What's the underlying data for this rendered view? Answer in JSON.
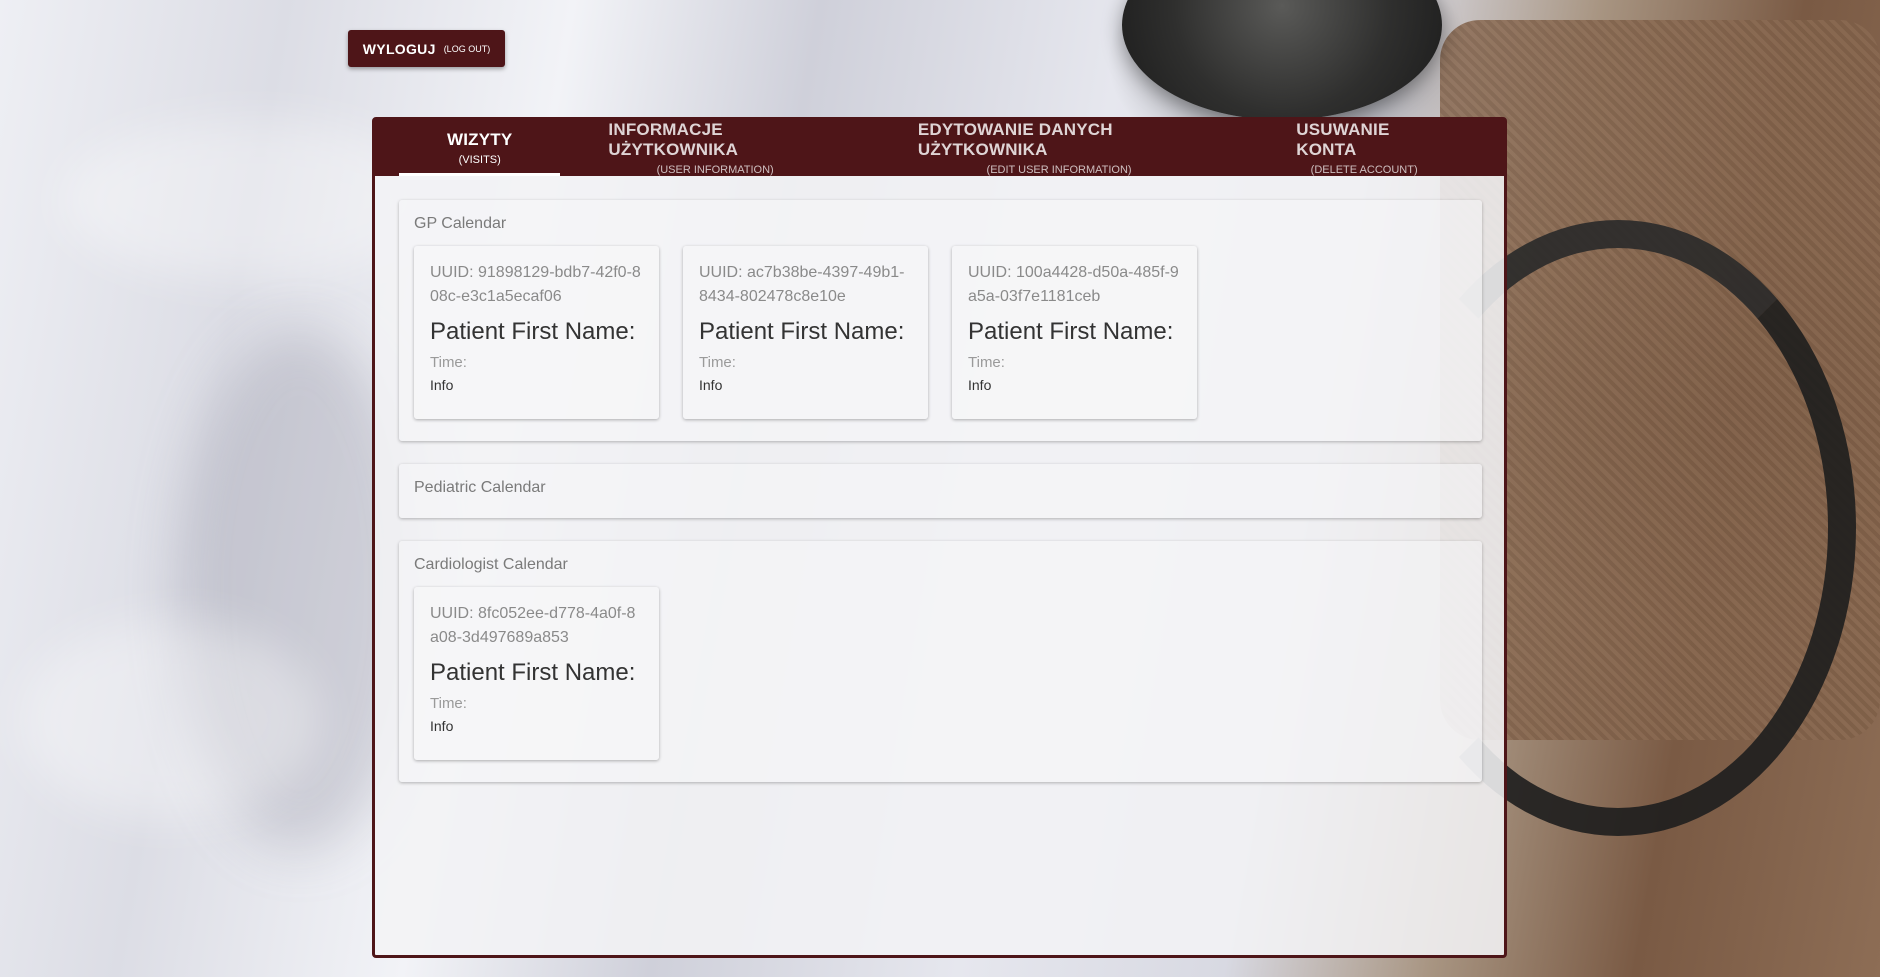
{
  "logout": {
    "label": "WYLOGUJ",
    "sublabel": "(LOG OUT)"
  },
  "tabs": [
    {
      "label": "WIZYTY",
      "sublabel": "(VISITS)",
      "active": true
    },
    {
      "label": "INFORMACJE UŻYTKOWNIKA",
      "sublabel": "(USER INFORMATION)",
      "active": false
    },
    {
      "label": "EDYTOWANIE DANYCH UŻYTKOWNIKA",
      "sublabel": "(EDIT USER INFORMATION)",
      "active": false
    },
    {
      "label": "USUWANIE KONTA",
      "sublabel": "(DELETE ACCOUNT)",
      "active": false
    }
  ],
  "calendars": {
    "gp": {
      "title": "GP Calendar",
      "visits": [
        {
          "uuid": "UUID: 91898129-bdb7-42f0-808c-e3c1a5ecaf06",
          "patient_label": "Patient First Name:",
          "time_label": "Time:",
          "info_label": "Info"
        },
        {
          "uuid": "UUID: ac7b38be-4397-49b1-8434-802478c8e10e",
          "patient_label": "Patient First Name:",
          "time_label": "Time:",
          "info_label": "Info"
        },
        {
          "uuid": "UUID: 100a4428-d50a-485f-9a5a-03f7e1181ceb",
          "patient_label": "Patient First Name:",
          "time_label": "Time:",
          "info_label": "Info"
        }
      ]
    },
    "pediatric": {
      "title": "Pediatric Calendar",
      "visits": []
    },
    "cardiologist": {
      "title": "Cardiologist Calendar",
      "visits": [
        {
          "uuid": "UUID: 8fc052ee-d778-4a0f-8a08-3d497689a853",
          "patient_label": "Patient First Name:",
          "time_label": "Time:",
          "info_label": "Info"
        }
      ]
    }
  },
  "colors": {
    "brand": "#4e1518",
    "panel_bg": "#f3f3f5"
  }
}
